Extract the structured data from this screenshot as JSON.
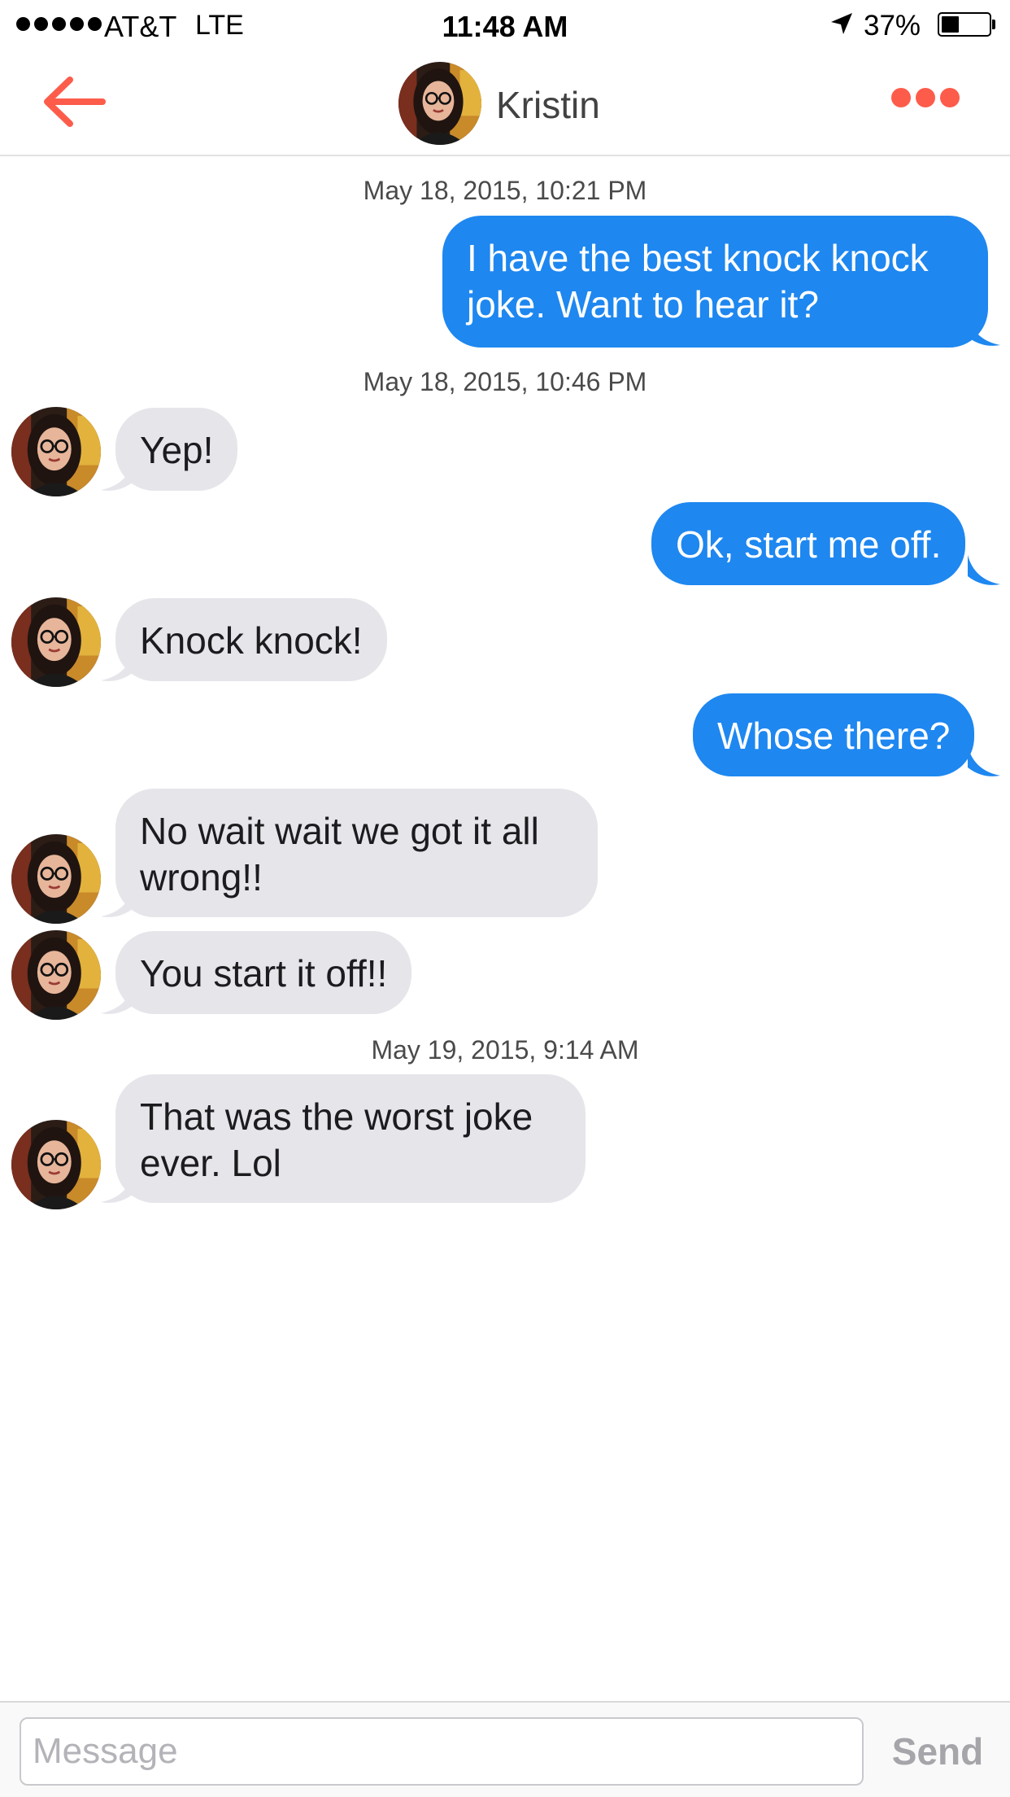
{
  "status_bar": {
    "carrier": "AT&T",
    "network": "LTE",
    "time": "11:48 AM",
    "battery_percent": "37%",
    "battery_level": 0.37,
    "signal_bars": 5
  },
  "header": {
    "contact_name": "Kristin",
    "back_icon": "arrow-left-icon",
    "more_icon": "more-dots-icon",
    "accent_color": "#fd5c4b"
  },
  "messages": {
    "ts1": "May 18, 2015, 10:21 PM",
    "m1": "I have the best knock knock\njoke. Want to hear it?",
    "ts2": "May 18, 2015, 10:46 PM",
    "m2": "Yep!",
    "m3": "Ok, start me off.",
    "m4": "Knock knock!",
    "m5": "Whose there?",
    "m6": "No wait wait we got it all\nwrong!!",
    "m7": "You start it off!!",
    "ts3": "May 19, 2015, 9:14 AM",
    "m8": "That was the worst joke\never. Lol"
  },
  "colors": {
    "outgoing_bubble": "#1e87f0",
    "incoming_bubble": "#e6e5ea"
  },
  "composer": {
    "placeholder": "Message",
    "send_label": "Send"
  }
}
